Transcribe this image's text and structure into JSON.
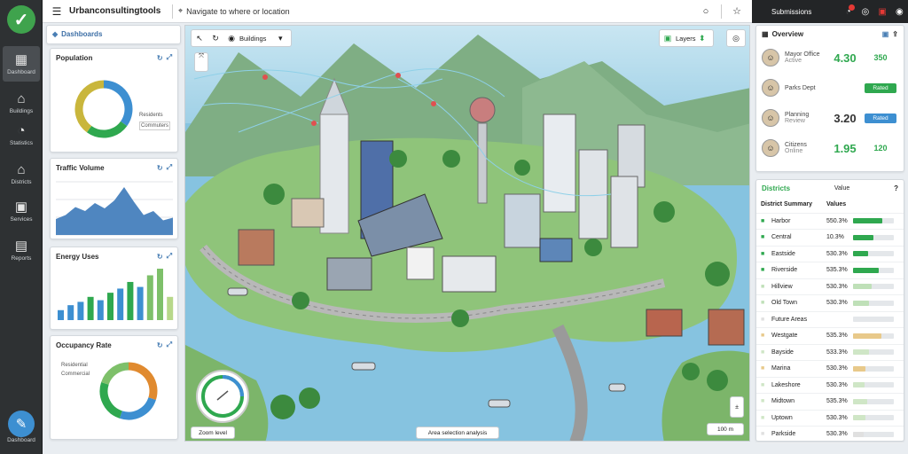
{
  "app": {
    "title": "Urbanconsultingtools"
  },
  "search": {
    "placeholder": "Navigate to where or location"
  },
  "colors": {
    "accent_green": "#2fa84f",
    "accent_blue": "#3d8fd1",
    "rail": "#2e3133"
  },
  "rail": {
    "items": [
      {
        "icon": "dashboard-icon",
        "glyph": "▦",
        "label": "Dashboard"
      },
      {
        "icon": "building-icon",
        "glyph": "⌂",
        "label": "Buildings"
      },
      {
        "icon": "analytics-icon",
        "glyph": "◔",
        "label": "Statistics"
      },
      {
        "icon": "house-icon",
        "glyph": "⌂",
        "label": "Districts"
      },
      {
        "icon": "briefcase-icon",
        "glyph": "▣",
        "label": "Services"
      },
      {
        "icon": "report-icon",
        "glyph": "▤",
        "label": "Reports"
      }
    ],
    "bottom_label": "Dashboard"
  },
  "topbar": {
    "right_label": "Submissions"
  },
  "widgets": {
    "donut1": {
      "title": "Population",
      "legend": [
        "Residents",
        "Commuters"
      ],
      "slices": [
        0.35,
        0.25,
        0.4
      ]
    },
    "area": {
      "title": "Traffic Volume",
      "values": [
        24,
        30,
        42,
        36,
        48,
        40,
        52,
        72,
        50,
        30,
        36,
        22,
        26
      ]
    },
    "bars": {
      "title": "Energy Uses",
      "values": [
        12,
        18,
        22,
        28,
        24,
        33,
        38,
        46,
        40,
        54,
        62,
        28
      ]
    },
    "donut2": {
      "title": "Occupancy Rate",
      "legend": [
        "Residential",
        "Commercial"
      ],
      "slices": [
        0.3,
        0.25,
        0.25,
        0.2
      ]
    }
  },
  "map": {
    "toolbar_label": "Buildings",
    "top_right_label": "Layers",
    "bottom_center_label": "Area selection analysis",
    "bottom_left_label": "Zoom level",
    "bottom_right_label": "100 m"
  },
  "profiles": {
    "title": "Overview",
    "rows": [
      {
        "name": "Mayor Office",
        "sub": "Active",
        "value": "4.30",
        "tag": "350"
      },
      {
        "name": "Parks Dept",
        "sub": "",
        "value": "",
        "tag": "Rated"
      },
      {
        "name": "Planning",
        "sub": "Review",
        "value": "3.20",
        "tag": "Rated"
      },
      {
        "name": "Citizens",
        "sub": "Online",
        "value": "1.95",
        "tag": "120"
      }
    ]
  },
  "table": {
    "title": "Districts",
    "count_label": "Value",
    "header": [
      "District Summary",
      "Values"
    ],
    "rows": [
      {
        "name": "Harbor",
        "value": "550.3%",
        "pct": 0.72,
        "color": "#2fa84f"
      },
      {
        "name": "Central",
        "value": "10.3%",
        "pct": 0.5,
        "color": "#2fa84f"
      },
      {
        "name": "Eastside",
        "value": "530.3%",
        "pct": 0.38,
        "color": "#2fa84f"
      },
      {
        "name": "Riverside",
        "value": "535.3%",
        "pct": 0.62,
        "color": "#2fa84f"
      },
      {
        "name": "Hillview",
        "value": "530.3%",
        "pct": 0.45,
        "color": "#bfe0b8"
      },
      {
        "name": "Old Town",
        "value": "530.3%",
        "pct": 0.4,
        "color": "#bfe0b8"
      },
      {
        "name": "Future Areas",
        "value": "",
        "pct": 0,
        "color": "#e0e0e0"
      },
      {
        "name": "Westgate",
        "value": "535.3%",
        "pct": 0.7,
        "color": "#e8c98a"
      },
      {
        "name": "Bayside",
        "value": "533.3%",
        "pct": 0.4,
        "color": "#cfe6c6"
      },
      {
        "name": "Marina",
        "value": "530.3%",
        "pct": 0.3,
        "color": "#e8c98a"
      },
      {
        "name": "Lakeshore",
        "value": "530.3%",
        "pct": 0.28,
        "color": "#cfe6c6"
      },
      {
        "name": "Midtown",
        "value": "535.3%",
        "pct": 0.35,
        "color": "#cfe6c6"
      },
      {
        "name": "Uptown",
        "value": "530.3%",
        "pct": 0.3,
        "color": "#cfe6c6"
      },
      {
        "name": "Parkside",
        "value": "530.3%",
        "pct": 0.25,
        "color": "#e0e0e0"
      }
    ]
  }
}
